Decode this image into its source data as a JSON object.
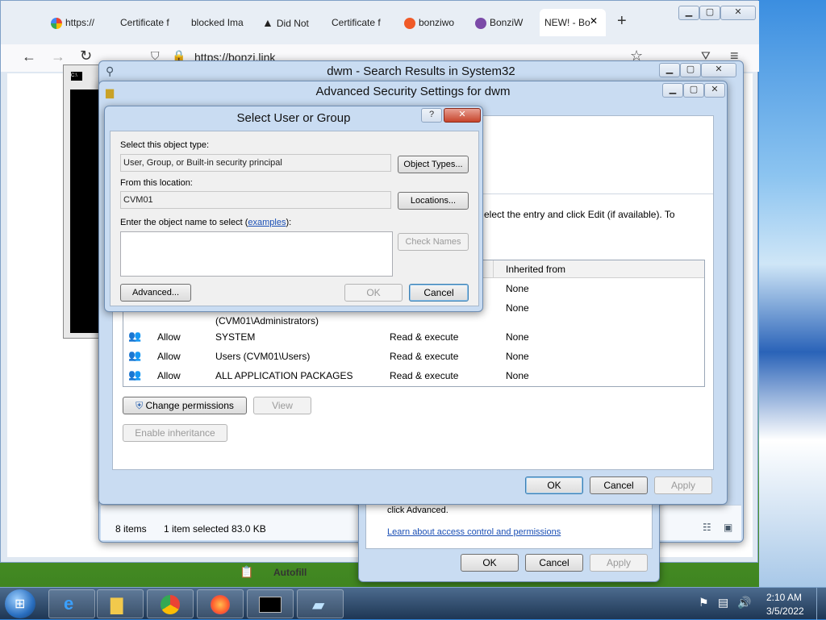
{
  "browser": {
    "tabs": [
      {
        "label": "https://",
        "icon": "google-icon"
      },
      {
        "label": "Certificate f",
        "icon": "none"
      },
      {
        "label": "blocked Ima",
        "icon": "none"
      },
      {
        "label": "Did Not",
        "icon": "warning-icon"
      },
      {
        "label": "Certificate f",
        "icon": "none"
      },
      {
        "label": "bonziwo",
        "icon": "brave-icon"
      },
      {
        "label": "BonziW",
        "icon": "bonzi-icon"
      },
      {
        "label": "NEW! - Bo",
        "icon": "none"
      }
    ],
    "close_tab_glyph": "✕",
    "new_tab_glyph": "+",
    "url": "https://bonzi.link",
    "back_glyph": "←",
    "forward_glyph": "→",
    "reload_glyph": "↻",
    "star_glyph": "☆",
    "menu_glyph": "≡",
    "autofill_label": "Autofill"
  },
  "explorer": {
    "title": "dwm - Search Results in System32",
    "status_items": "8 items",
    "status_selected": "1 item selected  83.0 KB"
  },
  "properties": {
    "advanced_text": "click Advanced.",
    "learn_link": "Learn about access control and permissions",
    "ok": "OK",
    "cancel": "Cancel",
    "apply": "Apply"
  },
  "security": {
    "title": "Advanced Security Settings for dwm",
    "instruction": "elect the entry and click Edit (if available). To",
    "col_inherited": "Inherited from",
    "rows": [
      {
        "type": "",
        "principal": "",
        "access": "",
        "inherited": "None"
      },
      {
        "type": "",
        "principal": "(CVM01\\Administrators)",
        "access": "",
        "inherited": "None"
      },
      {
        "type": "Allow",
        "principal": "SYSTEM",
        "access": "Read & execute",
        "inherited": "None"
      },
      {
        "type": "Allow",
        "principal": "Users (CVM01\\Users)",
        "access": "Read & execute",
        "inherited": "None"
      },
      {
        "type": "Allow",
        "principal": "ALL APPLICATION PACKAGES",
        "access": "Read & execute",
        "inherited": "None"
      }
    ],
    "change_permissions": "Change permissions",
    "view": "View",
    "enable_inheritance": "Enable inheritance",
    "ok": "OK",
    "cancel": "Cancel",
    "apply": "Apply"
  },
  "dialog": {
    "title": "Select User or Group",
    "help_glyph": "?",
    "close_glyph": "✕",
    "object_type_label": "Select this object type:",
    "object_type_value": "User, Group, or Built-in security principal",
    "object_types_button": "Object Types...",
    "location_label": "From this location:",
    "location_value": "CVM01",
    "locations_button": "Locations...",
    "enter_label": "Enter the object name to select (",
    "examples_link": "examples",
    "enter_label_end": "):",
    "object_name_value": "",
    "check_names_button": "Check Names",
    "advanced_button": "Advanced...",
    "ok_button": "OK",
    "cancel_button": "Cancel"
  },
  "cmd_icon_label": "C:\\",
  "taskbar": {
    "time": "2:10 AM",
    "date": "3/5/2022"
  }
}
